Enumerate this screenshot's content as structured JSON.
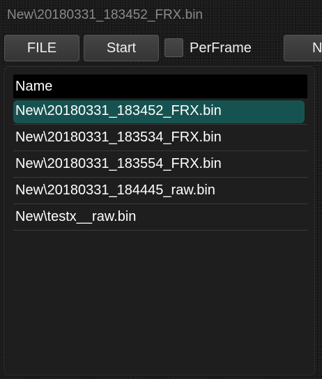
{
  "window": {
    "title": "New\\20180331_183452_FRX.bin"
  },
  "toolbar": {
    "file_label": "FILE",
    "start_label": "Start",
    "perframe_label": "PerFrame",
    "perframe_checked": false,
    "next_label": "N"
  },
  "file_list": {
    "header": "Name",
    "selected_index": 0,
    "items": [
      "New\\20180331_183452_FRX.bin",
      "New\\20180331_183534_FRX.bin",
      "New\\20180331_183554_FRX.bin",
      "New\\20180331_184445_raw.bin",
      "New\\testx__raw.bin"
    ]
  },
  "colors": {
    "selection": "#165350",
    "header_bg": "#000000",
    "title_text": "#8a8a8a"
  }
}
